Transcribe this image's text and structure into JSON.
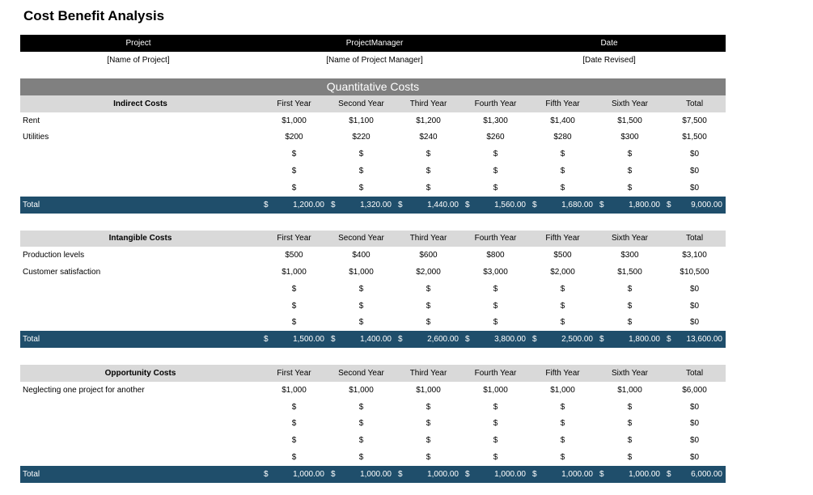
{
  "title": "Cost Benefit Analysis",
  "header": {
    "labels": [
      "Project",
      "ProjectManager",
      "Date"
    ],
    "values": [
      "[Name of Project]",
      "[Name of Project Manager]",
      "[Date Revised]"
    ]
  },
  "banner": "Quantitative Costs",
  "columns": [
    "First Year",
    "Second Year",
    "Third Year",
    "Fourth Year",
    "Fifth Year",
    "Sixth Year",
    "Total"
  ],
  "dollar": "$",
  "total_label": "Total",
  "sections": [
    {
      "name": "Indirect Costs",
      "rows": [
        {
          "label": "Rent",
          "values": [
            "$1,000",
            "$1,100",
            "$1,200",
            "$1,300",
            "$1,400",
            "$1,500",
            "$7,500"
          ]
        },
        {
          "label": "Utilities",
          "values": [
            "$200",
            "$220",
            "$240",
            "$260",
            "$280",
            "$300",
            "$1,500"
          ]
        },
        {
          "label": "",
          "values": [
            "$",
            "$",
            "$",
            "$",
            "$",
            "$",
            "$0"
          ]
        },
        {
          "label": "",
          "values": [
            "$",
            "$",
            "$",
            "$",
            "$",
            "$",
            "$0"
          ]
        },
        {
          "label": "",
          "values": [
            "$",
            "$",
            "$",
            "$",
            "$",
            "$",
            "$0"
          ]
        }
      ],
      "totals": [
        "1,200.00",
        "1,320.00",
        "1,440.00",
        "1,560.00",
        "1,680.00",
        "1,800.00",
        "9,000.00"
      ]
    },
    {
      "name": "Intangible Costs",
      "rows": [
        {
          "label": "Production levels",
          "values": [
            "$500",
            "$400",
            "$600",
            "$800",
            "$500",
            "$300",
            "$3,100"
          ]
        },
        {
          "label": "Customer satisfaction",
          "values": [
            "$1,000",
            "$1,000",
            "$2,000",
            "$3,000",
            "$2,000",
            "$1,500",
            "$10,500"
          ]
        },
        {
          "label": "",
          "values": [
            "$",
            "$",
            "$",
            "$",
            "$",
            "$",
            "$0"
          ]
        },
        {
          "label": "",
          "values": [
            "$",
            "$",
            "$",
            "$",
            "$",
            "$",
            "$0"
          ]
        },
        {
          "label": "",
          "values": [
            "$",
            "$",
            "$",
            "$",
            "$",
            "$",
            "$0"
          ]
        }
      ],
      "totals": [
        "1,500.00",
        "1,400.00",
        "2,600.00",
        "3,800.00",
        "2,500.00",
        "1,800.00",
        "13,600.00"
      ]
    },
    {
      "name": "Opportunity Costs",
      "rows": [
        {
          "label": "Neglecting one project for another",
          "values": [
            "$1,000",
            "$1,000",
            "$1,000",
            "$1,000",
            "$1,000",
            "$1,000",
            "$6,000"
          ]
        },
        {
          "label": "",
          "values": [
            "$",
            "$",
            "$",
            "$",
            "$",
            "$",
            "$0"
          ]
        },
        {
          "label": "",
          "values": [
            "$",
            "$",
            "$",
            "$",
            "$",
            "$",
            "$0"
          ]
        },
        {
          "label": "",
          "values": [
            "$",
            "$",
            "$",
            "$",
            "$",
            "$",
            "$0"
          ]
        },
        {
          "label": "",
          "values": [
            "$",
            "$",
            "$",
            "$",
            "$",
            "$",
            "$0"
          ]
        }
      ],
      "totals": [
        "1,000.00",
        "1,000.00",
        "1,000.00",
        "1,000.00",
        "1,000.00",
        "1,000.00",
        "6,000.00"
      ]
    }
  ]
}
